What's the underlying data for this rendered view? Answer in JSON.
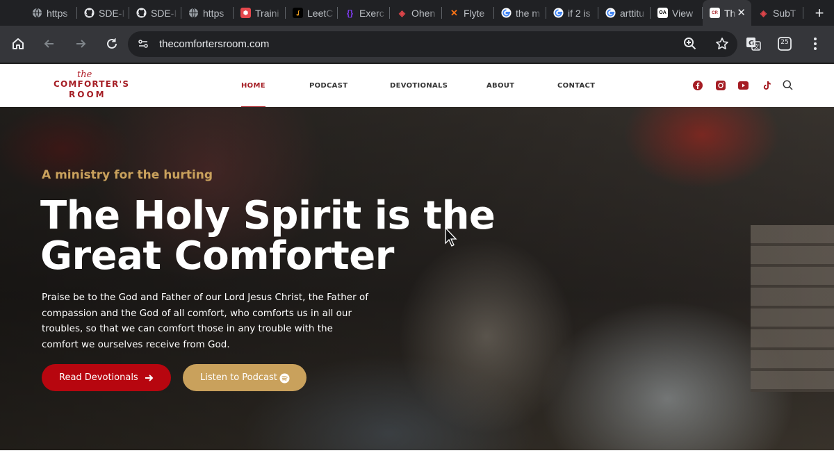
{
  "browser": {
    "tabs": [
      {
        "title": "https",
        "favicon": "globe-icon",
        "color": "#9aa0a6"
      },
      {
        "title": "SDE-I",
        "favicon": "github-icon",
        "color": "#e8eaed"
      },
      {
        "title": "SDE-I",
        "favicon": "github-icon",
        "color": "#e8eaed"
      },
      {
        "title": "https",
        "favicon": "globe-icon",
        "color": "#9aa0a6"
      },
      {
        "title": "Traini",
        "favicon": "hexagon-icon",
        "color": "#e5484d"
      },
      {
        "title": "LeetC",
        "favicon": "leetcode-icon",
        "color": "#f0a020"
      },
      {
        "title": "Exerc",
        "favicon": "exercism-icon",
        "color": "#7c3aed"
      },
      {
        "title": "Ohen",
        "favicon": "laravel-icon",
        "color": "#e0454a"
      },
      {
        "title": "Flyte",
        "favicon": "x-logo-icon",
        "color": "#f97316"
      },
      {
        "title": "the m",
        "favicon": "google-icon",
        "color": "#4285f4"
      },
      {
        "title": "if 2 is",
        "favicon": "google-icon",
        "color": "#4285f4"
      },
      {
        "title": "arttitu",
        "favicon": "google-icon",
        "color": "#4285f4"
      },
      {
        "title": "View",
        "favicon": "openai-icon",
        "color": "#ffffff"
      },
      {
        "title": "Th",
        "favicon": "site-favicon-icon",
        "color": "#a51d24",
        "active": true
      },
      {
        "title": "SubT",
        "favicon": "laravel-icon",
        "color": "#e0454a"
      }
    ],
    "address": "thecomfortersroom.com",
    "extension_badge": "25"
  },
  "site": {
    "logo": {
      "script": "the",
      "line1": "COMFORTER'S",
      "line2": "ROOM"
    },
    "nav": [
      {
        "label": "HOME",
        "active": true
      },
      {
        "label": "PODCAST"
      },
      {
        "label": "DEVOTIONALS"
      },
      {
        "label": "ABOUT"
      },
      {
        "label": "CONTACT"
      }
    ],
    "social_icons": [
      "facebook-icon",
      "instagram-icon",
      "youtube-icon",
      "tiktok-icon"
    ],
    "brand_color": "#a51d24",
    "accent_color": "#c9a15c"
  },
  "hero": {
    "eyebrow": "A ministry for the hurting",
    "heading_line1": "The Holy Spirit is the",
    "heading_line2": "Great Comforter",
    "paragraph": "Praise be to the God and Father of our Lord Jesus Christ, the Father of compassion and the God of all comfort, who comforts us in all our troubles, so that we can comfort those in any trouble with the comfort we ourselves receive from God.",
    "primary_button": "Read Devotionals",
    "secondary_button": "Listen to Podcast"
  }
}
